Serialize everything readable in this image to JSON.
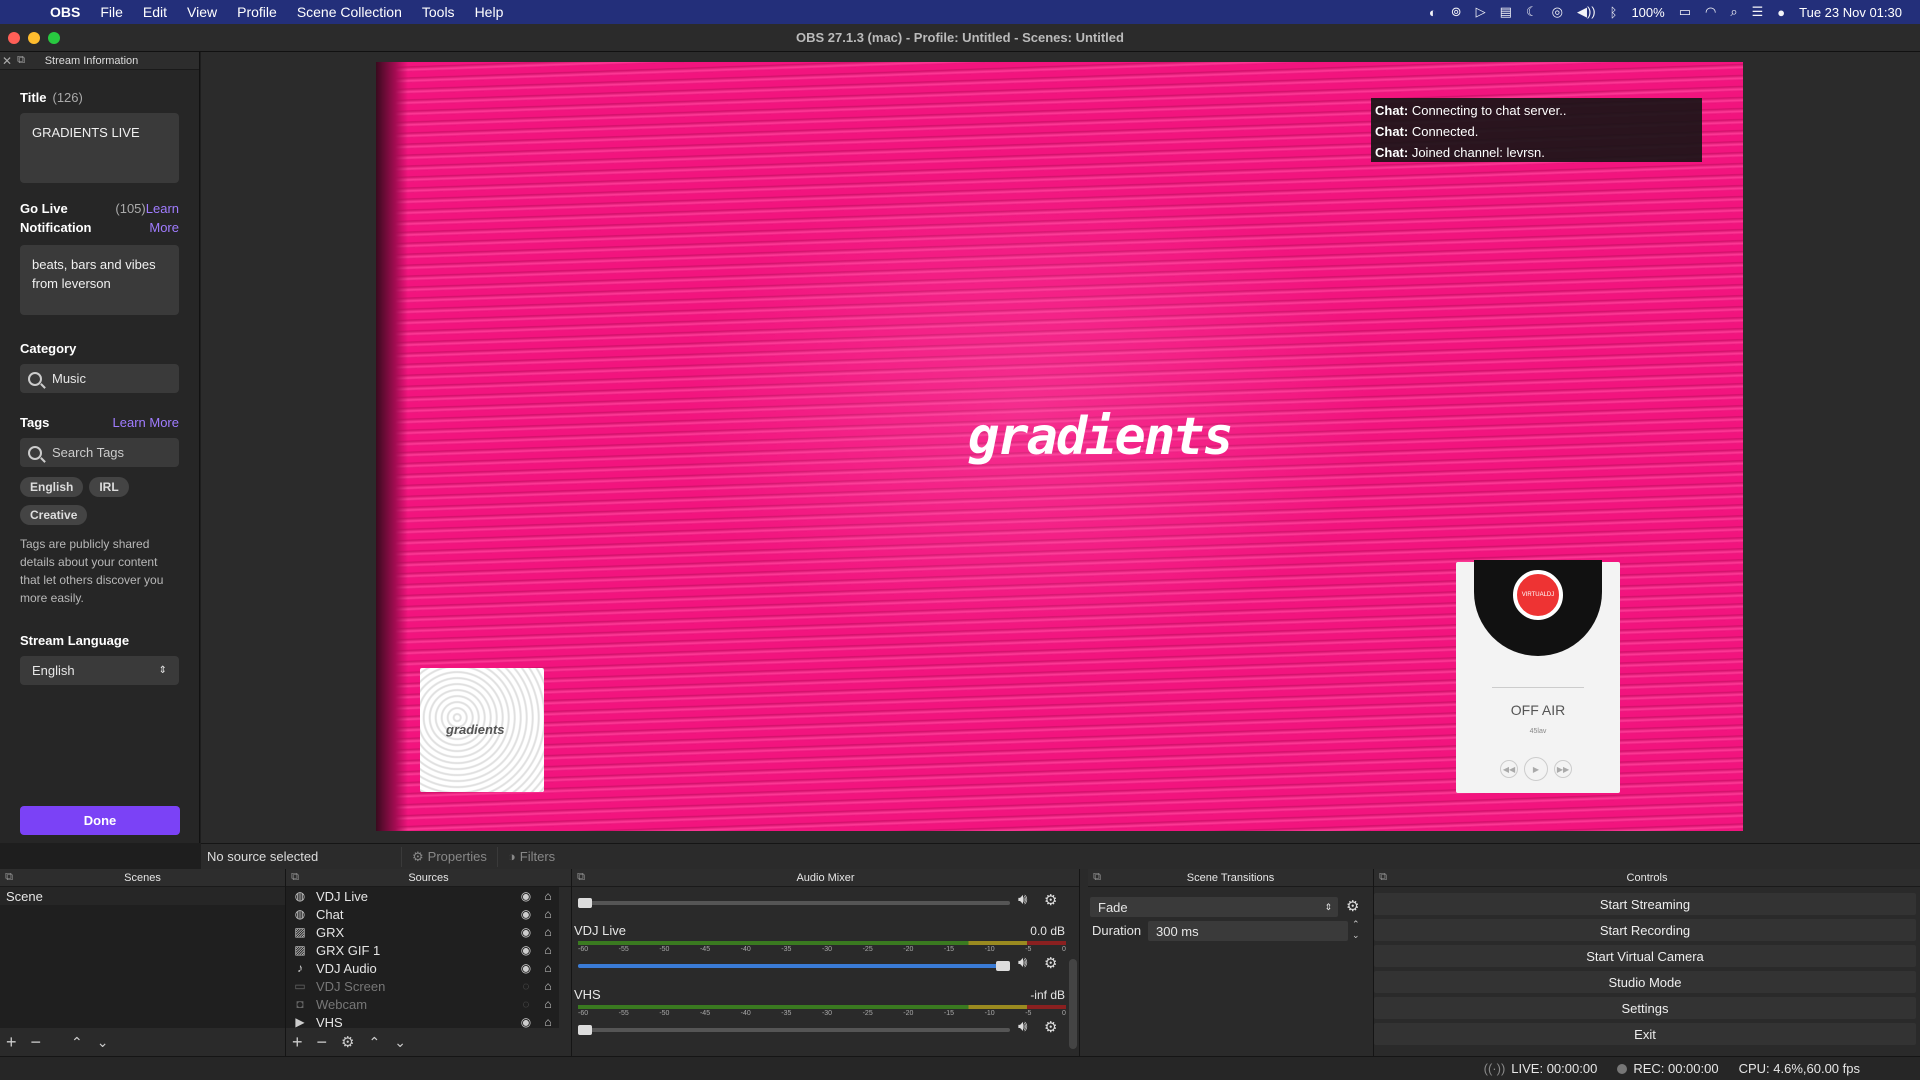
{
  "menubar": {
    "app": "OBS",
    "items": [
      "File",
      "Edit",
      "View",
      "Profile",
      "Scene Collection",
      "Tools",
      "Help"
    ],
    "battery": "100%",
    "clock": "Tue 23 Nov  01:30"
  },
  "window": {
    "title": "OBS 27.1.3 (mac) - Profile: Untitled - Scenes: Untitled"
  },
  "stream_info": {
    "dock_title": "Stream Information",
    "title_label": "Title",
    "title_count": "(126)",
    "title_value": "GRADIENTS LIVE",
    "golive_label_1": "Go Live",
    "golive_label_2": "Notification",
    "golive_count": "(105)",
    "golive_learn_1": "Learn",
    "golive_learn_2": "More",
    "golive_value": "beats, bars and vibes from leverson",
    "category_label": "Category",
    "category_value": "Music",
    "tags_label": "Tags",
    "tags_learn": "Learn More",
    "tags_placeholder": "Search Tags",
    "tags": [
      "English",
      "IRL",
      "Creative"
    ],
    "tags_help": "Tags are publicly shared details about your content that let others discover you more easily.",
    "lang_label": "Stream Language",
    "lang_value": "English",
    "done": "Done"
  },
  "preview": {
    "logo_text": "gradients",
    "chat": [
      {
        "who": "Chat:",
        "msg": " Connecting to chat server.."
      },
      {
        "who": "Chat:",
        "msg": " Connected."
      },
      {
        "who": "Chat:",
        "msg": " Joined channel: levrsn."
      }
    ],
    "wave_text": "gradients",
    "player_label": "VIRTUALDJ",
    "player_status": "OFF AIR",
    "player_sub": "45lav"
  },
  "source_bar": {
    "status": "No source selected",
    "properties": "Properties",
    "filters": "Filters"
  },
  "scenes": {
    "title": "Scenes",
    "items": [
      "Scene"
    ]
  },
  "sources": {
    "title": "Sources",
    "items": [
      {
        "name": "VDJ Live",
        "icon": "globe-icon",
        "visible": true
      },
      {
        "name": "Chat",
        "icon": "globe-icon",
        "visible": true
      },
      {
        "name": "GRX",
        "icon": "image-icon",
        "visible": true
      },
      {
        "name": "GRX GIF 1",
        "icon": "image-icon",
        "visible": true
      },
      {
        "name": "VDJ Audio",
        "icon": "mic-icon",
        "visible": true
      },
      {
        "name": "VDJ Screen",
        "icon": "monitor-icon",
        "visible": false
      },
      {
        "name": "Webcam",
        "icon": "camera-icon",
        "visible": false
      },
      {
        "name": "VHS",
        "icon": "play-icon",
        "visible": true
      }
    ]
  },
  "mixer": {
    "title": "Audio Mixer",
    "scale": [
      "-60",
      "-55",
      "-50",
      "-45",
      "-40",
      "-35",
      "-30",
      "-25",
      "-20",
      "-15",
      "-10",
      "-5",
      "0"
    ],
    "tracks": [
      {
        "name": "VDJ Live",
        "db": "0.0 dB",
        "level": 1.0
      },
      {
        "name": "VHS",
        "db": "-inf dB",
        "level": 0.0
      }
    ]
  },
  "transitions": {
    "title": "Scene Transitions",
    "type": "Fade",
    "duration_label": "Duration",
    "duration": "300 ms"
  },
  "controls": {
    "title": "Controls",
    "buttons": [
      "Start Streaming",
      "Start Recording",
      "Start Virtual Camera",
      "Studio Mode",
      "Settings",
      "Exit"
    ]
  },
  "status": {
    "live": "LIVE: 00:00:00",
    "rec": "REC: 00:00:00",
    "cpu": "CPU: 4.6%,60.00 fps"
  },
  "colors": {
    "accent": "#7b42f6",
    "link": "#a07cff",
    "menubar": "#232f7a",
    "preview": "#f2147e"
  }
}
